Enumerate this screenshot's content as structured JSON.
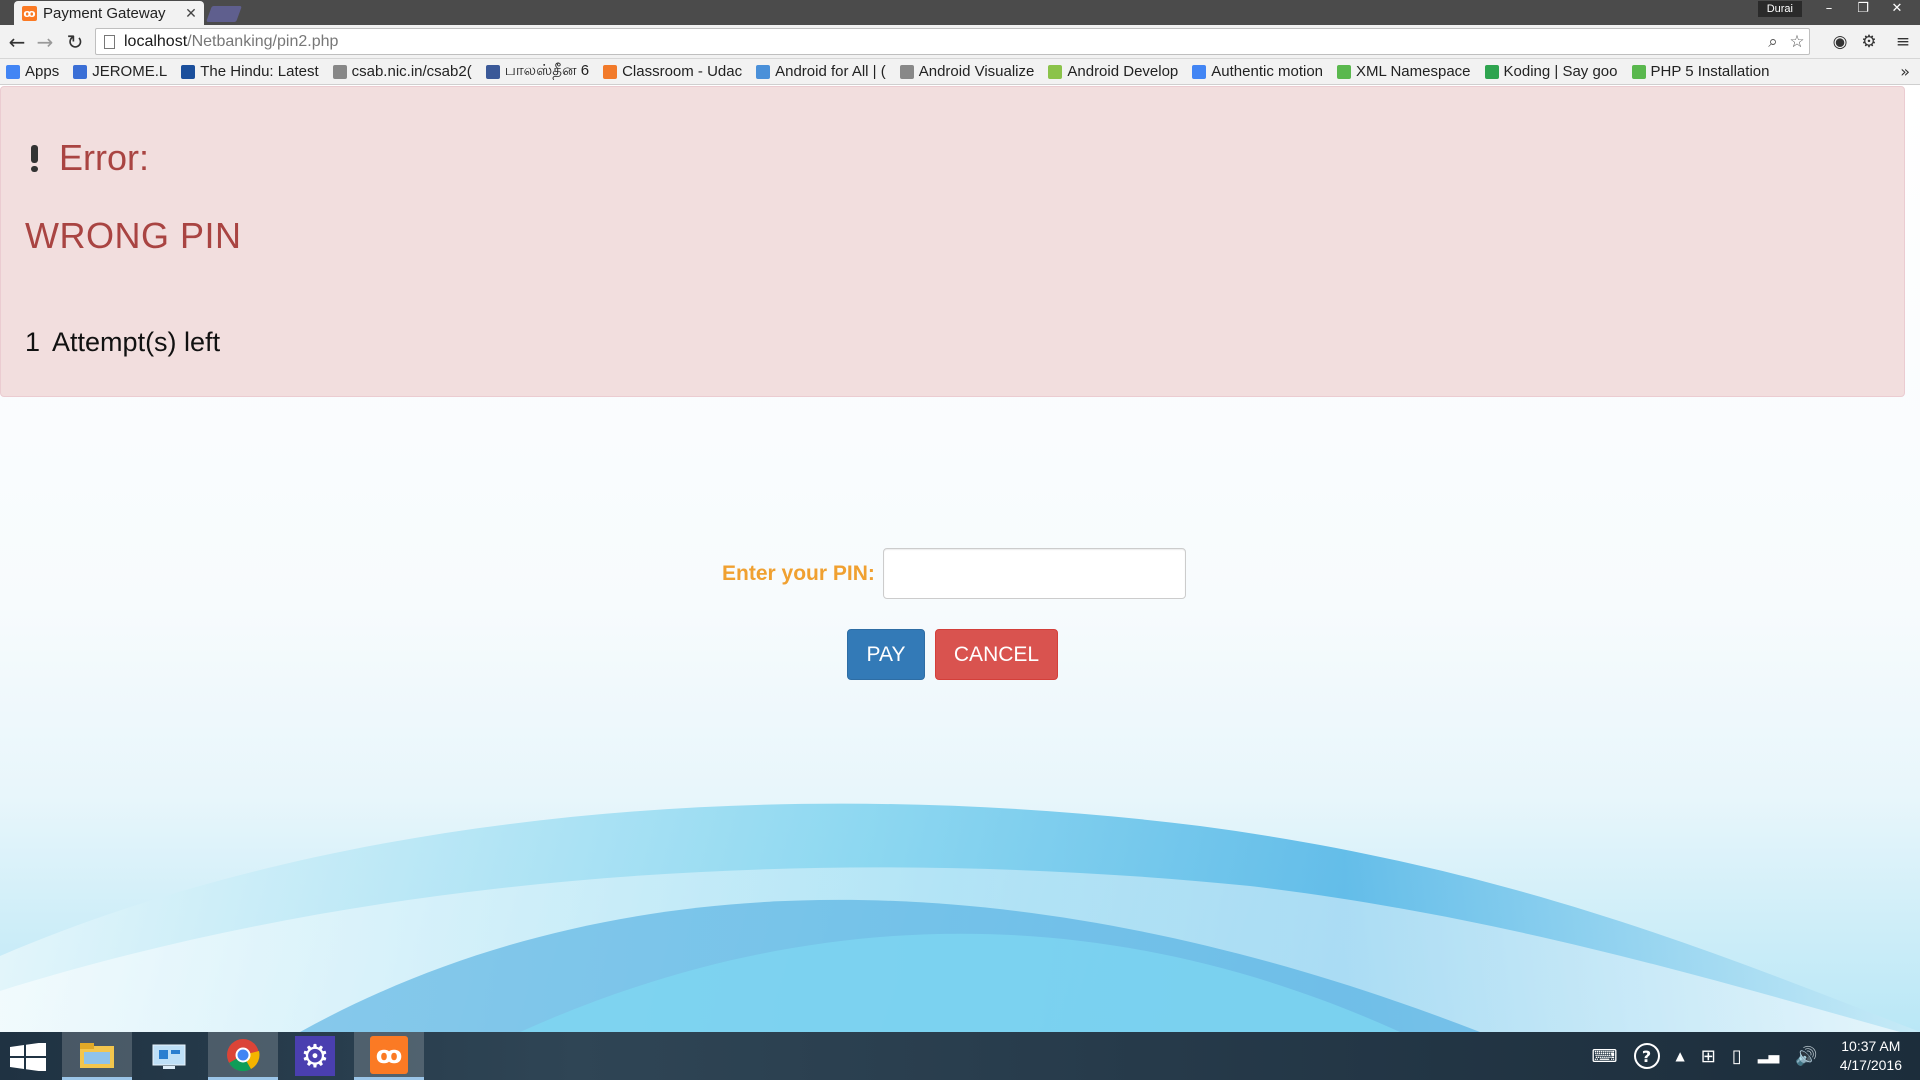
{
  "browser": {
    "tab_title": "Payment Gateway",
    "tab_favicon": "xampp-icon",
    "profile_name": "Durai",
    "url_host": "localhost",
    "url_path": "/Netbanking/pin2.php",
    "bookmarks": [
      {
        "label": "Apps",
        "icon": "apps-grid-icon",
        "color": "#4285f4"
      },
      {
        "label": "JEROME.L",
        "icon": "page-icon",
        "color": "#3b6fd6"
      },
      {
        "label": "The Hindu: Latest",
        "icon": "the-hindu-icon",
        "color": "#1b4f9c"
      },
      {
        "label": "csab.nic.in/csab2(",
        "icon": "page-icon",
        "color": "#888888"
      },
      {
        "label": "பாலஸ்தீன 6",
        "icon": "facebook-icon",
        "color": "#3b5998"
      },
      {
        "label": "Classroom - Udac",
        "icon": "udacity-icon",
        "color": "#f27a2a"
      },
      {
        "label": "Android for All | (",
        "icon": "code-icon",
        "color": "#4a90d9"
      },
      {
        "label": "Android Visualize",
        "icon": "page-icon",
        "color": "#888888"
      },
      {
        "label": "Android Develop",
        "icon": "android-icon",
        "color": "#8bc34a"
      },
      {
        "label": "Authentic motion",
        "icon": "google-icon",
        "color": "#4285f4"
      },
      {
        "label": "XML Namespace",
        "icon": "w3schools-icon",
        "color": "#5ab84e"
      },
      {
        "label": "Koding | Say goo",
        "icon": "koding-icon",
        "color": "#2ea44f"
      },
      {
        "label": "PHP 5 Installation",
        "icon": "w3schools-icon",
        "color": "#5ab84e"
      }
    ]
  },
  "alert": {
    "title": "Error:",
    "message": "WRONG PIN",
    "attempts_count": "1",
    "attempts_text": "Attempt(s) left"
  },
  "form": {
    "pin_label": "Enter your PIN:",
    "pin_value": "",
    "pay_label": "PAY",
    "cancel_label": "CANCEL"
  },
  "taskbar": {
    "apps": [
      "file-explorer-icon",
      "remote-desktop-icon",
      "chrome-icon",
      "settings-gear-icon",
      "xampp-icon"
    ],
    "time": "10:37 AM",
    "date": "4/17/2016"
  },
  "colors": {
    "alert_bg": "#f2dede",
    "alert_text": "#a94442",
    "pin_label": "#f0a030",
    "pay_button": "#337ab7",
    "cancel_button": "#d9534f"
  }
}
